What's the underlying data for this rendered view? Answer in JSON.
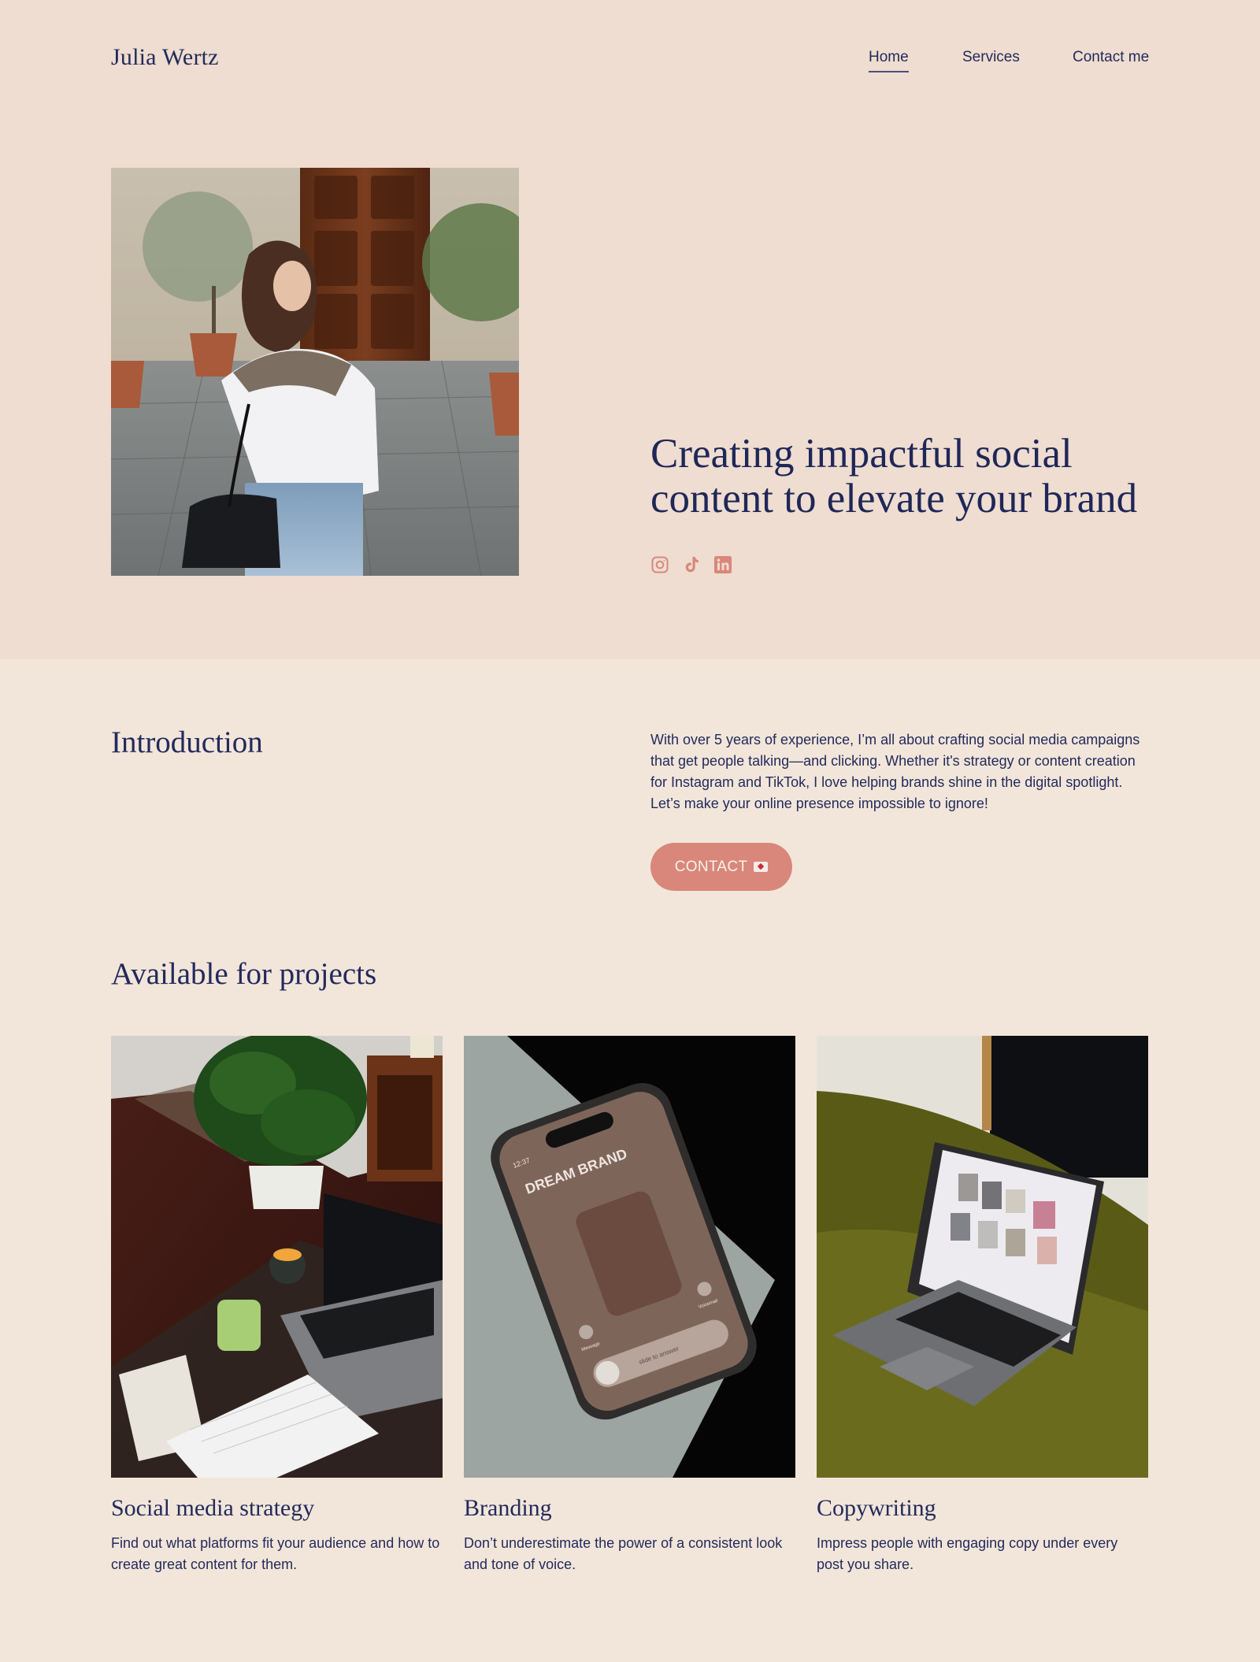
{
  "header": {
    "logo": "Julia Wertz",
    "nav": [
      {
        "label": "Home",
        "active": true
      },
      {
        "label": "Services",
        "active": false
      },
      {
        "label": "Contact me",
        "active": false
      }
    ]
  },
  "hero": {
    "image_alt": "Woman in white shirt with sweater over shoulders standing in a courtyard",
    "headline": "Creating impactful social content to elevate your brand",
    "socials": [
      {
        "name": "instagram-icon",
        "label": "Instagram"
      },
      {
        "name": "tiktok-icon",
        "label": "TikTok"
      },
      {
        "name": "linkedin-icon",
        "label": "LinkedIn"
      }
    ]
  },
  "intro": {
    "title": "Introduction",
    "text": "With over 5 years of experience, I’m all about crafting social media campaigns that get people talking—and clicking. Whether it's strategy or content creation for Instagram and TikTok, I love helping brands shine in the digital spotlight. Let’s make your online presence impossible to ignore!",
    "button_label": "CONTACT"
  },
  "projects": {
    "title": "Available for projects",
    "cards": [
      {
        "title": "Social media strategy",
        "description": "Find out what platforms fit your audience and how to create great content for them.",
        "image_alt": "Desk with laptop, candle, matcha and plant"
      },
      {
        "title": "Branding",
        "description": "Don’t underestimate the power of a consistent look and tone of voice.",
        "image_alt": "Phone showing incoming call from DREAM BRAND"
      },
      {
        "title": "Copywriting",
        "description": "Impress people with engaging copy under every post you share.",
        "image_alt": "Laptop on green velvet chair showing moodboard"
      }
    ],
    "phone_screen": {
      "time": "12:37",
      "caller": "DREAM BRAND",
      "message_label": "Message",
      "voicemail_label": "Voicemail",
      "slider_label": "slide to answer"
    }
  },
  "colors": {
    "hero_bg": "#EEDDD0",
    "page_bg": "#F2E6DA",
    "text": "#232A5C",
    "accent": "#D9877A"
  }
}
